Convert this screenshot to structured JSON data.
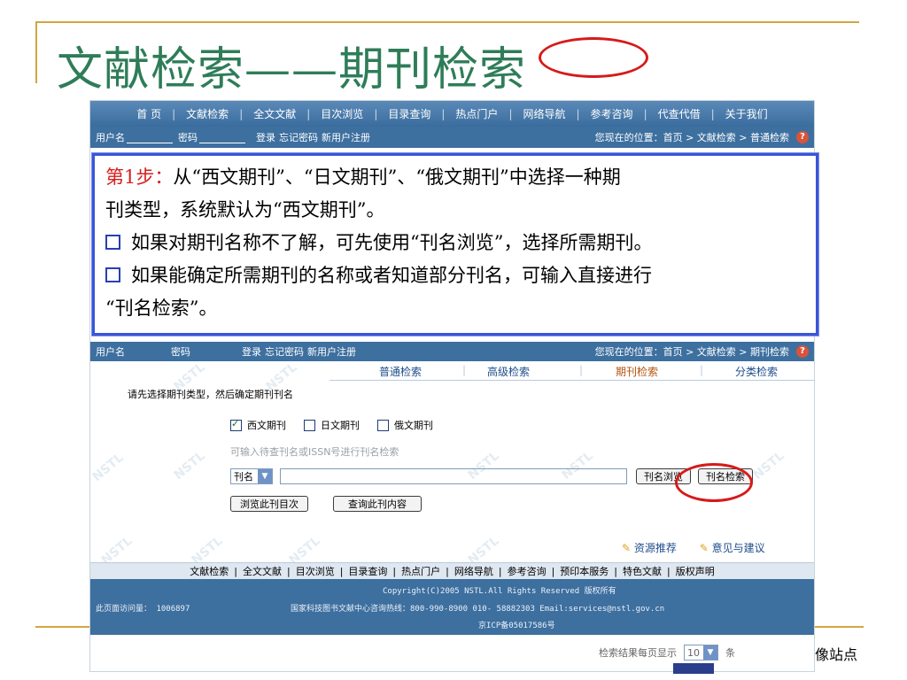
{
  "slide": {
    "title": "文献检索——期刊检索",
    "right_note": "像站点"
  },
  "nav": {
    "items": [
      "首 页",
      "文献检索",
      "全文文献",
      "目次浏览",
      "目录查询",
      "热点门户",
      "网络导航",
      "参考咨询",
      "代查代借",
      "关于我们"
    ]
  },
  "login": {
    "username_label": "用户名",
    "password_label": "密码",
    "login": "登录",
    "forgot": "忘记密码",
    "register": "新用户注册",
    "location_top": "您现在的位置：首页 > 文献检索 > 普通检索",
    "location": "您现在的位置：首页 > 文献检索 > 期刊检索",
    "help": "?"
  },
  "callout": {
    "step_label": "第1步：",
    "line1": "从“西文期刊”、“日文期刊”、“俄文期刊”中选择一种期",
    "line2": "刊类型，系统默认为“西文期刊”。",
    "bullet1": "如果对期刊名称不了解，可先使用“刊名浏览”，选择所需期刊。",
    "bullet2": "如果能确定所需期刊的名称或者知道部分刊名，可输入直接进行",
    "line5": "“刊名检索”。"
  },
  "tabs": {
    "items": [
      "普通检索",
      "高级检索",
      "期刊检索",
      "分类检索"
    ],
    "active_index": 2
  },
  "watermark": "NSTL",
  "form": {
    "prompt": "请先选择期刊类型，然后确定期刊刊名",
    "types": [
      {
        "label": "西文期刊",
        "checked": true
      },
      {
        "label": "日文期刊",
        "checked": false
      },
      {
        "label": "俄文期刊",
        "checked": false
      }
    ],
    "hint": "可输入待查刊名或ISSN号进行刊名检索",
    "field_select": "刊名",
    "browse_button": "刊名浏览",
    "search_button": "刊名检索",
    "toc_button": "浏览此刊目次",
    "content_button": "查询此刊内容"
  },
  "links": {
    "resource": "资源推荐",
    "feedback": "意见与建议"
  },
  "footer_nav": {
    "items": [
      "文献检索",
      "全文文献",
      "目次浏览",
      "目录查询",
      "热点门户",
      "网络导航",
      "参考咨询",
      "预印本服务",
      "特色文献",
      "版权声明"
    ]
  },
  "footer": {
    "copyright": "Copyright(C)2005 NSTL.All Rights Reserved 版权所有",
    "visits_label": "此页面访问量：",
    "visits": "1006897",
    "hotline": "国家科技图书文献中心咨询热线：800-990-8900 010- 58882303 Email:services@nstl.gov.cn",
    "icp": "京ICP备05017586号"
  },
  "results": {
    "per_page_label": "检索结果每页显示",
    "per_page_value": "10",
    "unit": "条"
  },
  "colors": {
    "title": "#2e7d58",
    "accent_gold": "#d4a640",
    "header_blue": "#3d6f9f",
    "callout_border": "#3a55d8",
    "highlight_red": "#d61a1a",
    "active_tab": "#b5530f"
  }
}
